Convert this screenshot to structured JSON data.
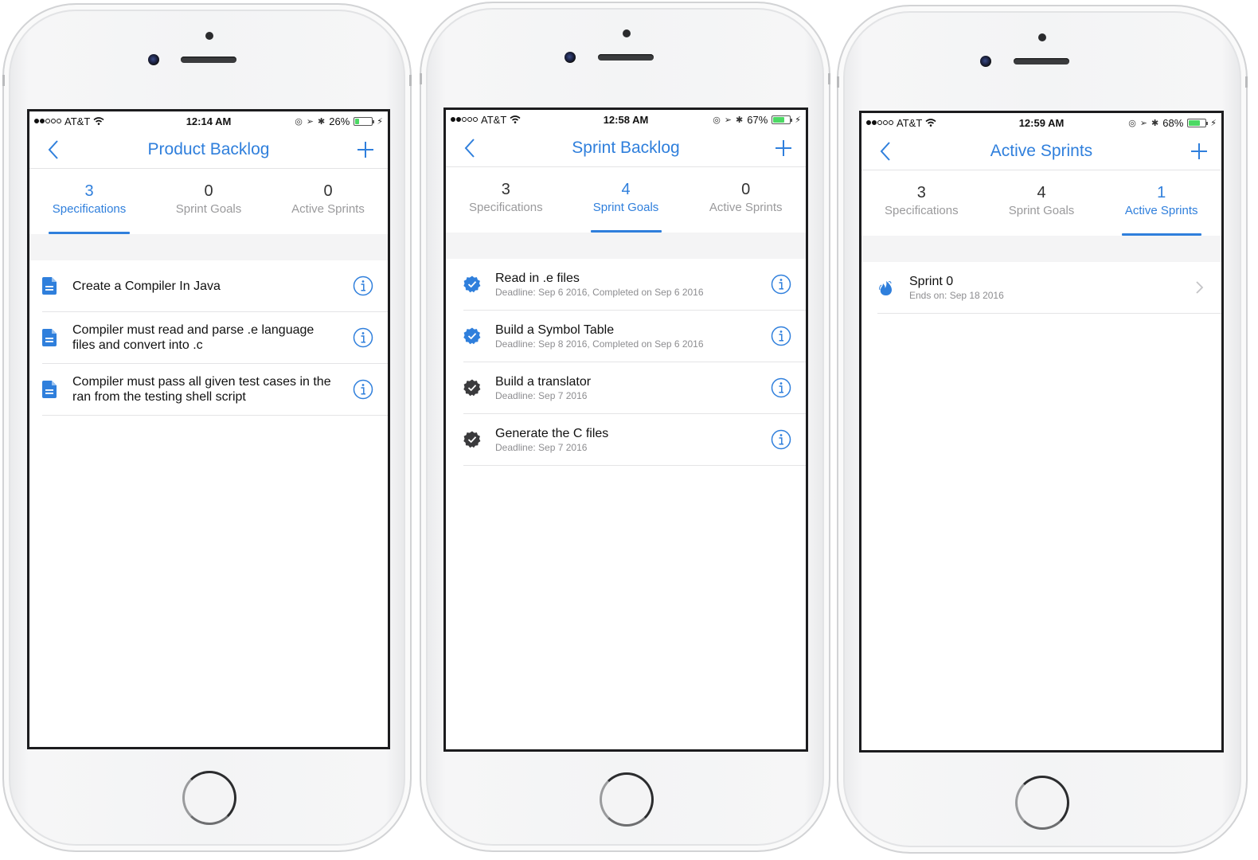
{
  "colors": {
    "accent": "#2f7fdc",
    "completed_badge": "#2f7fdc",
    "pending_badge": "#3a3a3c",
    "battery_fill": "#4cd964",
    "muted_text": "#9a9a9c"
  },
  "phones": [
    {
      "status": {
        "carrier": "AT&T",
        "signal_bars_filled": 2,
        "signal_bars_total": 5,
        "time": "12:14 AM",
        "battery_percent_label": "26%",
        "battery_level": 0.26
      },
      "nav": {
        "title": "Product Backlog",
        "back_icon": "chevron-left-icon",
        "add_icon": "plus-icon"
      },
      "tabs": [
        {
          "count": "3",
          "label": "Specifications",
          "active": true
        },
        {
          "count": "0",
          "label": "Sprint Goals",
          "active": false
        },
        {
          "count": "0",
          "label": "Active Sprints",
          "active": false
        }
      ],
      "items": [
        {
          "icon": "document-icon",
          "title": "Create a Compiler In Java",
          "trailing": "info-icon"
        },
        {
          "icon": "document-icon",
          "title": "Compiler must read and parse .e language files and convert into .c",
          "trailing": "info-icon"
        },
        {
          "icon": "document-icon",
          "title": "Compiler must pass all given test cases in the ran from the testing shell script",
          "trailing": "info-icon"
        }
      ]
    },
    {
      "status": {
        "carrier": "AT&T",
        "signal_bars_filled": 2,
        "signal_bars_total": 5,
        "time": "12:58 AM",
        "battery_percent_label": "67%",
        "battery_level": 0.67
      },
      "nav": {
        "title": "Sprint Backlog",
        "back_icon": "chevron-left-icon",
        "add_icon": "plus-icon"
      },
      "tabs": [
        {
          "count": "3",
          "label": "Specifications",
          "active": false
        },
        {
          "count": "4",
          "label": "Sprint Goals",
          "active": true
        },
        {
          "count": "0",
          "label": "Active Sprints",
          "active": false
        }
      ],
      "items": [
        {
          "icon": "verified-badge-icon",
          "completed": true,
          "title": "Read in .e files",
          "subtitle": "Deadline: Sep 6 2016, Completed on Sep 6 2016",
          "trailing": "info-icon"
        },
        {
          "icon": "verified-badge-icon",
          "completed": true,
          "title": "Build a Symbol Table",
          "subtitle": "Deadline: Sep 8 2016, Completed on Sep 6 2016",
          "trailing": "info-icon"
        },
        {
          "icon": "verified-badge-icon",
          "completed": false,
          "title": "Build a translator",
          "subtitle": "Deadline: Sep 7 2016",
          "trailing": "info-icon"
        },
        {
          "icon": "verified-badge-icon",
          "completed": false,
          "title": "Generate the C files",
          "subtitle": "Deadline: Sep 7 2016",
          "trailing": "info-icon"
        }
      ]
    },
    {
      "status": {
        "carrier": "AT&T",
        "signal_bars_filled": 2,
        "signal_bars_total": 5,
        "time": "12:59 AM",
        "battery_percent_label": "68%",
        "battery_level": 0.68
      },
      "nav": {
        "title": "Active Sprints",
        "back_icon": "chevron-left-icon",
        "add_icon": "plus-icon"
      },
      "tabs": [
        {
          "count": "3",
          "label": "Specifications",
          "active": false
        },
        {
          "count": "4",
          "label": "Sprint Goals",
          "active": false
        },
        {
          "count": "1",
          "label": "Active Sprints",
          "active": true
        }
      ],
      "items": [
        {
          "icon": "fire-icon",
          "title": "Sprint 0",
          "subtitle": "Ends on: Sep 18 2016",
          "trailing": "chevron-right-icon"
        }
      ]
    }
  ]
}
